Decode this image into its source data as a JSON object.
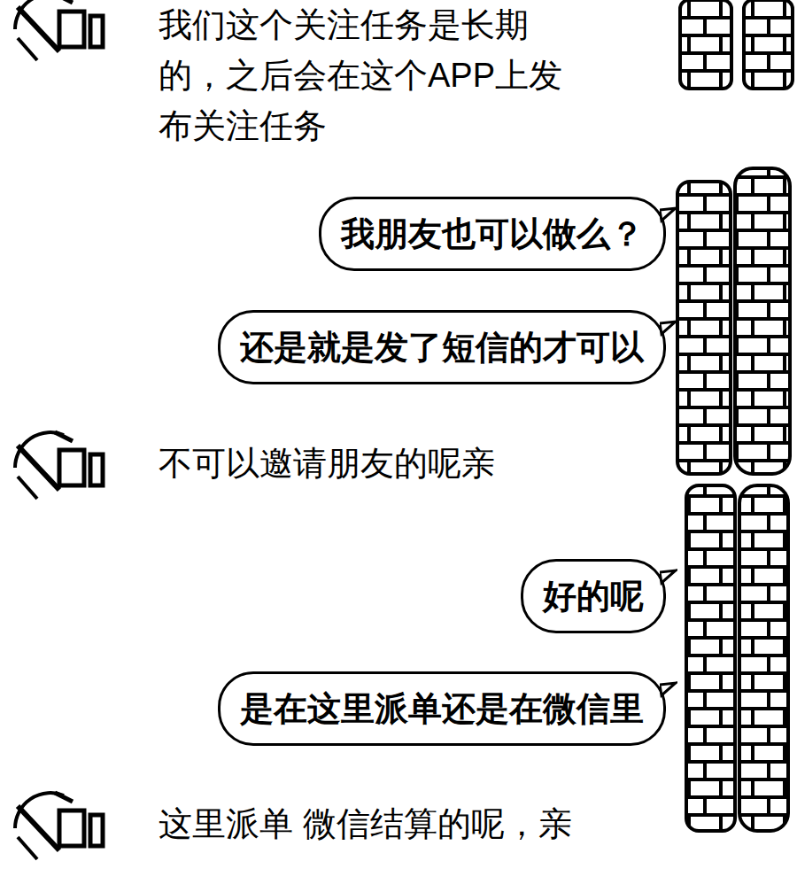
{
  "messages": [
    {
      "kind": "received",
      "text": "我们这个关注任务是长期的，之后会在这个APP上发布关注任务"
    },
    {
      "kind": "sent",
      "text": "我朋友也可以做么？"
    },
    {
      "kind": "sent",
      "text": "还是就是发了短信的才可以"
    },
    {
      "kind": "received",
      "text": "不可以邀请朋友的呢亲"
    },
    {
      "kind": "sent",
      "text": "好的呢"
    },
    {
      "kind": "sent",
      "text": "是在这里派单还是在微信里"
    },
    {
      "kind": "received",
      "text": "这里派单 微信结算的呢，亲"
    }
  ]
}
